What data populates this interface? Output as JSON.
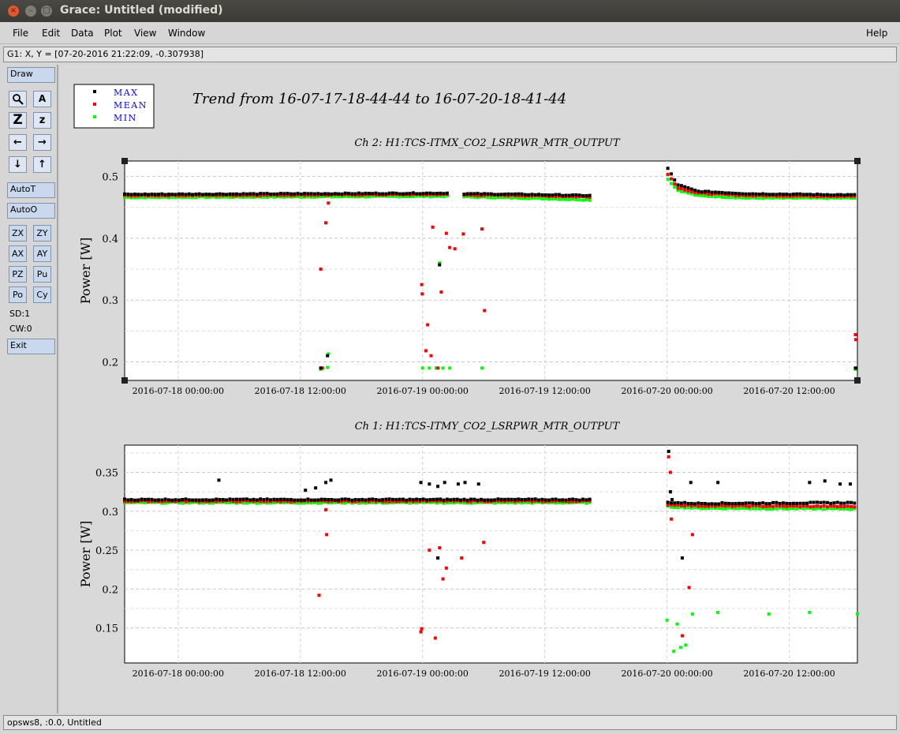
{
  "window": {
    "title": "Grace: Untitled (modified)",
    "close_label": "×",
    "min_label": "–",
    "max_label": "□"
  },
  "menubar": {
    "items": [
      {
        "label": "File"
      },
      {
        "label": "Edit"
      },
      {
        "label": "Data"
      },
      {
        "label": "Plot"
      },
      {
        "label": "View"
      },
      {
        "label": "Window"
      }
    ],
    "help_label": "Help"
  },
  "locator": {
    "text": "G1: X, Y = [07-20-2016 21:22:09, -0.307938]"
  },
  "toolbar": {
    "draw": "Draw",
    "zoom_icon": "magnifier-icon",
    "autotick_icon_label": "A",
    "zoom_z_label": "Z",
    "zoom_z_small_label": "z",
    "left_label": "←",
    "right_label": "→",
    "down_label": "↓",
    "up_label": "↑",
    "autot": "AutoT",
    "autoo": "AutoO",
    "zx": "ZX",
    "zy": "ZY",
    "ax": "AX",
    "ay": "AY",
    "pz": "PZ",
    "pu": "Pu",
    "po": "Po",
    "cy": "Cy",
    "sd": "SD:1",
    "cw": "CW:0",
    "exit": "Exit"
  },
  "status": {
    "text": "opsws8, :0.0, Untitled"
  },
  "plot": {
    "main_title": "Trend from 16-07-17-18-44-44 to 16-07-20-18-41-44",
    "legend": [
      {
        "label": "MAX",
        "color": "#000000"
      },
      {
        "label": "MEAN",
        "color": "#ff0000"
      },
      {
        "label": "MIN",
        "color": "#00ff00"
      }
    ]
  },
  "chart_data": [
    {
      "type": "scatter",
      "title": "Ch 2: H1:TCS-ITMX_CO2_LSRPWR_MTR_OUTPUT",
      "ylabel": "Power [W]",
      "xlabel": "",
      "xlim": [
        "2016-07-17 18:44:44",
        "2016-07-20 18:41:44"
      ],
      "ylim": [
        0.17,
        0.525
      ],
      "yticks": [
        0.2,
        0.3,
        0.4,
        0.5
      ],
      "xticks": [
        "2016-07-18 00:00:00",
        "2016-07-18 12:00:00",
        "2016-07-19 00:00:00",
        "2016-07-19 12:00:00",
        "2016-07-20 00:00:00",
        "2016-07-20 12:00:00"
      ],
      "grid": true,
      "gaps": [
        [
          "2016-07-19 02:40",
          "2016-07-19 04:00"
        ],
        [
          "2016-07-19 16:30",
          "2016-07-19 23:45"
        ]
      ],
      "series": [
        {
          "name": "MAX",
          "color": "#000000",
          "baseline": [
            [
              "2016-07-17 18:44",
              0.471
            ],
            [
              "2016-07-18 12:00",
              0.472
            ],
            [
              "2016-07-19 02:40",
              0.473
            ],
            [
              "2016-07-19 04:00",
              0.472
            ],
            [
              "2016-07-19 10:00",
              0.471
            ],
            [
              "2016-07-19 16:30",
              0.469
            ],
            [
              "2016-07-19 23:50",
              0.52
            ],
            [
              "2016-07-20 01:00",
              0.487
            ],
            [
              "2016-07-20 03:00",
              0.476
            ],
            [
              "2016-07-20 08:00",
              0.472
            ],
            [
              "2016-07-20 18:41",
              0.47
            ]
          ],
          "outliers": [
            [
              "2016-07-18 14:00",
              0.19
            ],
            [
              "2016-07-18 14:40",
              0.21
            ],
            [
              "2016-07-19 01:40",
              0.357
            ],
            [
              "2016-07-20 18:30",
              0.19
            ]
          ]
        },
        {
          "name": "MEAN",
          "color": "#ff0000",
          "baseline": [
            [
              "2016-07-17 18:44",
              0.469
            ],
            [
              "2016-07-18 12:00",
              0.47
            ],
            [
              "2016-07-19 02:40",
              0.471
            ],
            [
              "2016-07-19 04:00",
              0.47
            ],
            [
              "2016-07-19 10:00",
              0.469
            ],
            [
              "2016-07-19 16:30",
              0.467
            ],
            [
              "2016-07-19 23:50",
              0.51
            ],
            [
              "2016-07-20 01:00",
              0.482
            ],
            [
              "2016-07-20 03:00",
              0.473
            ],
            [
              "2016-07-20 08:00",
              0.469
            ],
            [
              "2016-07-20 18:41",
              0.468
            ]
          ],
          "outliers": [
            [
              "2016-07-18 14:00",
              0.35
            ],
            [
              "2016-07-18 14:30",
              0.425
            ],
            [
              "2016-07-18 14:45",
              0.457
            ],
            [
              "2016-07-18 14:10",
              0.19
            ],
            [
              "2016-07-18 23:55",
              0.325
            ],
            [
              "2016-07-18 23:58",
              0.31
            ],
            [
              "2016-07-19 00:30",
              0.26
            ],
            [
              "2016-07-19 00:20",
              0.218
            ],
            [
              "2016-07-19 00:50",
              0.21
            ],
            [
              "2016-07-19 01:00",
              0.418
            ],
            [
              "2016-07-19 01:50",
              0.313
            ],
            [
              "2016-07-19 02:20",
              0.408
            ],
            [
              "2016-07-19 02:40",
              0.385
            ],
            [
              "2016-07-19 03:10",
              0.383
            ],
            [
              "2016-07-19 04:00",
              0.407
            ],
            [
              "2016-07-19 05:50",
              0.415
            ],
            [
              "2016-07-19 06:05",
              0.283
            ],
            [
              "2016-07-19 01:30",
              0.19
            ],
            [
              "2016-07-20 18:30",
              0.244
            ],
            [
              "2016-07-20 18:32",
              0.236
            ]
          ]
        },
        {
          "name": "MIN",
          "color": "#00ff00",
          "baseline": [
            [
              "2016-07-17 18:44",
              0.466
            ],
            [
              "2016-07-18 12:00",
              0.467
            ],
            [
              "2016-07-19 02:40",
              0.468
            ],
            [
              "2016-07-19 04:00",
              0.467
            ],
            [
              "2016-07-19 10:00",
              0.465
            ],
            [
              "2016-07-19 16:30",
              0.462
            ],
            [
              "2016-07-19 23:50",
              0.5
            ],
            [
              "2016-07-20 01:00",
              0.478
            ],
            [
              "2016-07-20 03:00",
              0.469
            ],
            [
              "2016-07-20 08:00",
              0.465
            ],
            [
              "2016-07-20 18:41",
              0.465
            ]
          ],
          "outliers": [
            [
              "2016-07-18 14:00",
              0.188
            ],
            [
              "2016-07-18 14:40",
              0.191
            ],
            [
              "2016-07-18 14:45",
              0.213
            ],
            [
              "2016-07-19 00:00",
              0.19
            ],
            [
              "2016-07-19 00:40",
              0.19
            ],
            [
              "2016-07-19 01:20",
              0.19
            ],
            [
              "2016-07-19 02:00",
              0.19
            ],
            [
              "2016-07-19 02:40",
              0.19
            ],
            [
              "2016-07-19 05:50",
              0.19
            ],
            [
              "2016-07-19 01:40",
              0.36
            ],
            [
              "2016-07-20 18:30",
              0.188
            ]
          ]
        }
      ]
    },
    {
      "type": "scatter",
      "title": "Ch 1: H1:TCS-ITMY_CO2_LSRPWR_MTR_OUTPUT",
      "ylabel": "Power [W]",
      "xlabel": "",
      "xlim": [
        "2016-07-17 18:44:44",
        "2016-07-20 18:41:44"
      ],
      "ylim": [
        0.105,
        0.385
      ],
      "yticks": [
        0.15,
        0.2,
        0.25,
        0.3,
        0.35
      ],
      "xticks": [
        "2016-07-18 00:00:00",
        "2016-07-18 12:00:00",
        "2016-07-19 00:00:00",
        "2016-07-19 12:00:00",
        "2016-07-20 00:00:00",
        "2016-07-20 12:00:00"
      ],
      "grid": true,
      "gaps": [
        [
          "2016-07-19 16:30",
          "2016-07-19 23:45"
        ]
      ],
      "series": [
        {
          "name": "MAX",
          "color": "#000000",
          "baseline": [
            [
              "2016-07-17 18:44",
              0.315
            ],
            [
              "2016-07-19 16:30",
              0.315
            ],
            [
              "2016-07-20 03:00",
              0.31
            ],
            [
              "2016-07-20 18:41",
              0.311
            ]
          ],
          "outliers": [
            [
              "2016-07-18 04:00",
              0.34
            ],
            [
              "2016-07-18 12:30",
              0.327
            ],
            [
              "2016-07-18 13:30",
              0.33
            ],
            [
              "2016-07-18 14:30",
              0.337
            ],
            [
              "2016-07-18 15:00",
              0.34
            ],
            [
              "2016-07-18 23:50",
              0.337
            ],
            [
              "2016-07-19 00:40",
              0.335
            ],
            [
              "2016-07-19 01:30",
              0.332
            ],
            [
              "2016-07-19 02:10",
              0.337
            ],
            [
              "2016-07-19 03:30",
              0.335
            ],
            [
              "2016-07-19 04:10",
              0.337
            ],
            [
              "2016-07-19 05:30",
              0.335
            ],
            [
              "2016-07-19 01:30",
              0.24
            ],
            [
              "2016-07-20 00:10",
              0.377
            ],
            [
              "2016-07-20 00:20",
              0.325
            ],
            [
              "2016-07-20 00:30",
              0.315
            ],
            [
              "2016-07-20 01:30",
              0.24
            ],
            [
              "2016-07-20 02:20",
              0.337
            ],
            [
              "2016-07-20 05:00",
              0.337
            ],
            [
              "2016-07-20 14:00",
              0.337
            ],
            [
              "2016-07-20 15:30",
              0.339
            ],
            [
              "2016-07-20 17:00",
              0.335
            ],
            [
              "2016-07-20 18:00",
              0.335
            ]
          ]
        },
        {
          "name": "MEAN",
          "color": "#ff0000",
          "baseline": [
            [
              "2016-07-17 18:44",
              0.313
            ],
            [
              "2016-07-19 16:30",
              0.313
            ],
            [
              "2016-07-20 03:00",
              0.307
            ],
            [
              "2016-07-20 18:41",
              0.306
            ]
          ],
          "outliers": [
            [
              "2016-07-18 14:30",
              0.302
            ],
            [
              "2016-07-18 14:35",
              0.27
            ],
            [
              "2016-07-18 13:50",
              0.192
            ],
            [
              "2016-07-18 23:50",
              0.145
            ],
            [
              "2016-07-18 23:55",
              0.149
            ],
            [
              "2016-07-19 00:40",
              0.25
            ],
            [
              "2016-07-19 01:15",
              0.137
            ],
            [
              "2016-07-19 01:40",
              0.253
            ],
            [
              "2016-07-19 02:00",
              0.213
            ],
            [
              "2016-07-19 02:20",
              0.227
            ],
            [
              "2016-07-19 03:50",
              0.24
            ],
            [
              "2016-07-19 06:00",
              0.26
            ],
            [
              "2016-07-20 00:10",
              0.37
            ],
            [
              "2016-07-20 00:20",
              0.35
            ],
            [
              "2016-07-20 00:25",
              0.29
            ],
            [
              "2016-07-20 01:30",
              0.14
            ],
            [
              "2016-07-20 02:30",
              0.27
            ],
            [
              "2016-07-20 02:10",
              0.202
            ]
          ]
        },
        {
          "name": "MIN",
          "color": "#00ff00",
          "baseline": [
            [
              "2016-07-17 18:44",
              0.311
            ],
            [
              "2016-07-19 16:30",
              0.311
            ],
            [
              "2016-07-20 03:00",
              0.304
            ],
            [
              "2016-07-20 18:41",
              0.303
            ]
          ],
          "outliers": [
            [
              "2016-07-19 01:30",
              0.24
            ],
            [
              "2016-07-20 00:00",
              0.16
            ],
            [
              "2016-07-20 00:20",
              0.325
            ],
            [
              "2016-07-20 01:00",
              0.155
            ],
            [
              "2016-07-20 00:40",
              0.12
            ],
            [
              "2016-07-20 01:20",
              0.125
            ],
            [
              "2016-07-20 01:50",
              0.128
            ],
            [
              "2016-07-20 02:30",
              0.168
            ],
            [
              "2016-07-20 05:00",
              0.17
            ],
            [
              "2016-07-20 10:00",
              0.168
            ],
            [
              "2016-07-20 14:00",
              0.17
            ],
            [
              "2016-07-20 18:41",
              0.168
            ]
          ]
        }
      ]
    }
  ]
}
